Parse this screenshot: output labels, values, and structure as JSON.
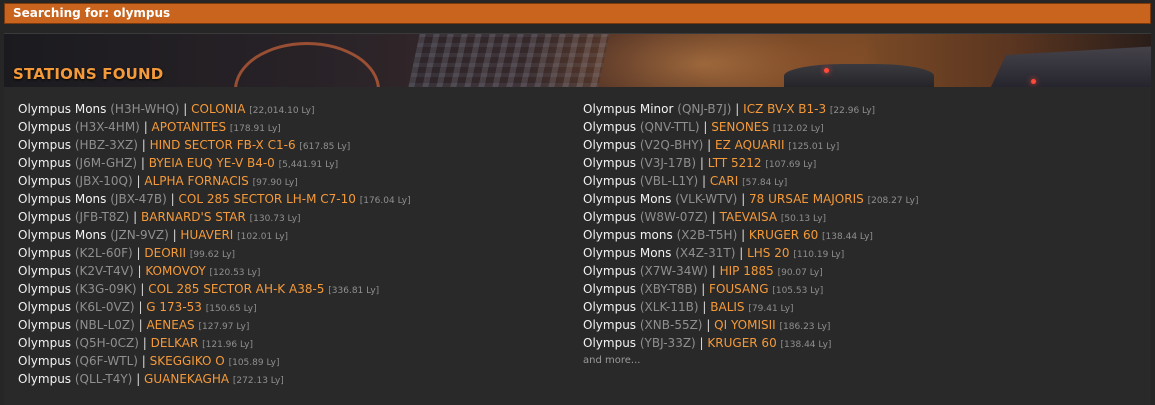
{
  "search": {
    "label": "Searching for: olympus"
  },
  "header": {
    "title": "STATIONS FOUND"
  },
  "stations_left": [
    {
      "name": "Olympus Mons",
      "code": "(H3H-WHQ)",
      "system": "COLONIA",
      "distance": "[22,014.10 Ly]"
    },
    {
      "name": "Olympus",
      "code": "(H3X-4HM)",
      "system": "APOTANITES",
      "distance": "[178.91 Ly]"
    },
    {
      "name": "Olympus",
      "code": "(HBZ-3XZ)",
      "system": "HIND SECTOR FB-X C1-6",
      "distance": "[617.85 Ly]"
    },
    {
      "name": "Olympus",
      "code": "(J6M-GHZ)",
      "system": "BYEIA EUQ YE-V B4-0",
      "distance": "[5,441.91 Ly]"
    },
    {
      "name": "Olympus",
      "code": "(JBX-10Q)",
      "system": "ALPHA FORNACIS",
      "distance": "[97.90 Ly]"
    },
    {
      "name": "Olympus Mons",
      "code": "(JBX-47B)",
      "system": "COL 285 SECTOR LH-M C7-10",
      "distance": "[176.04 Ly]"
    },
    {
      "name": "Olympus",
      "code": "(JFB-T8Z)",
      "system": "BARNARD'S STAR",
      "distance": "[130.73 Ly]"
    },
    {
      "name": "Olympus Mons",
      "code": "(JZN-9VZ)",
      "system": "HUAVERI",
      "distance": "[102.01 Ly]"
    },
    {
      "name": "Olympus",
      "code": "(K2L-60F)",
      "system": "DEORII",
      "distance": "[99.62 Ly]"
    },
    {
      "name": "Olympus",
      "code": "(K2V-T4V)",
      "system": "KOMOVOY",
      "distance": "[120.53 Ly]"
    },
    {
      "name": "Olympus",
      "code": "(K3G-09K)",
      "system": "COL 285 SECTOR AH-K A38-5",
      "distance": "[336.81 Ly]"
    },
    {
      "name": "Olympus",
      "code": "(K6L-0VZ)",
      "system": "G 173-53",
      "distance": "[150.65 Ly]"
    },
    {
      "name": "Olympus",
      "code": "(NBL-L0Z)",
      "system": "AENEAS",
      "distance": "[127.97 Ly]"
    },
    {
      "name": "Olympus",
      "code": "(Q5H-0CZ)",
      "system": "DELKAR",
      "distance": "[121.96 Ly]"
    },
    {
      "name": "Olympus",
      "code": "(Q6F-WTL)",
      "system": "SKEGGIKO O",
      "distance": "[105.89 Ly]"
    },
    {
      "name": "Olympus",
      "code": "(QLL-T4Y)",
      "system": "GUANEKAGHA",
      "distance": "[272.13 Ly]"
    }
  ],
  "stations_right": [
    {
      "name": "Olympus Minor",
      "code": "(QNJ-B7J)",
      "system": "ICZ BV-X B1-3",
      "distance": "[22.96 Ly]"
    },
    {
      "name": "Olympus",
      "code": "(QNV-TTL)",
      "system": "SENONES",
      "distance": "[112.02 Ly]"
    },
    {
      "name": "Olympus",
      "code": "(V2Q-BHY)",
      "system": "EZ AQUARII",
      "distance": "[125.01 Ly]"
    },
    {
      "name": "Olympus",
      "code": "(V3J-17B)",
      "system": "LTT 5212",
      "distance": "[107.69 Ly]"
    },
    {
      "name": "Olympus",
      "code": "(VBL-L1Y)",
      "system": "CARI",
      "distance": "[57.84 Ly]"
    },
    {
      "name": "Olympus Mons",
      "code": "(VLK-WTV)",
      "system": "78 URSAE MAJORIS",
      "distance": "[208.27 Ly]"
    },
    {
      "name": "Olympus",
      "code": "(W8W-07Z)",
      "system": "TAEVAISA",
      "distance": "[50.13 Ly]"
    },
    {
      "name": "Olympus mons",
      "code": "(X2B-T5H)",
      "system": "KRUGER 60",
      "distance": "[138.44 Ly]"
    },
    {
      "name": "Olympus Mons",
      "code": "(X4Z-31T)",
      "system": "LHS 20",
      "distance": "[110.19 Ly]"
    },
    {
      "name": "Olympus",
      "code": "(X7W-34W)",
      "system": "HIP 1885",
      "distance": "[90.07 Ly]"
    },
    {
      "name": "Olympus",
      "code": "(XBY-T8B)",
      "system": "FOUSANG",
      "distance": "[105.53 Ly]"
    },
    {
      "name": "Olympus",
      "code": "(XLK-11B)",
      "system": "BALIS",
      "distance": "[79.41 Ly]"
    },
    {
      "name": "Olympus",
      "code": "(XNB-55Z)",
      "system": "QI YOMISII",
      "distance": "[186.23 Ly]"
    },
    {
      "name": "Olympus",
      "code": "(YBJ-33Z)",
      "system": "KRUGER 60",
      "distance": "[138.44 Ly]"
    }
  ],
  "more_label": "and more...",
  "colors": {
    "accent": "#f59a3a",
    "search_bar": "#c8641d",
    "background": "#262626"
  }
}
